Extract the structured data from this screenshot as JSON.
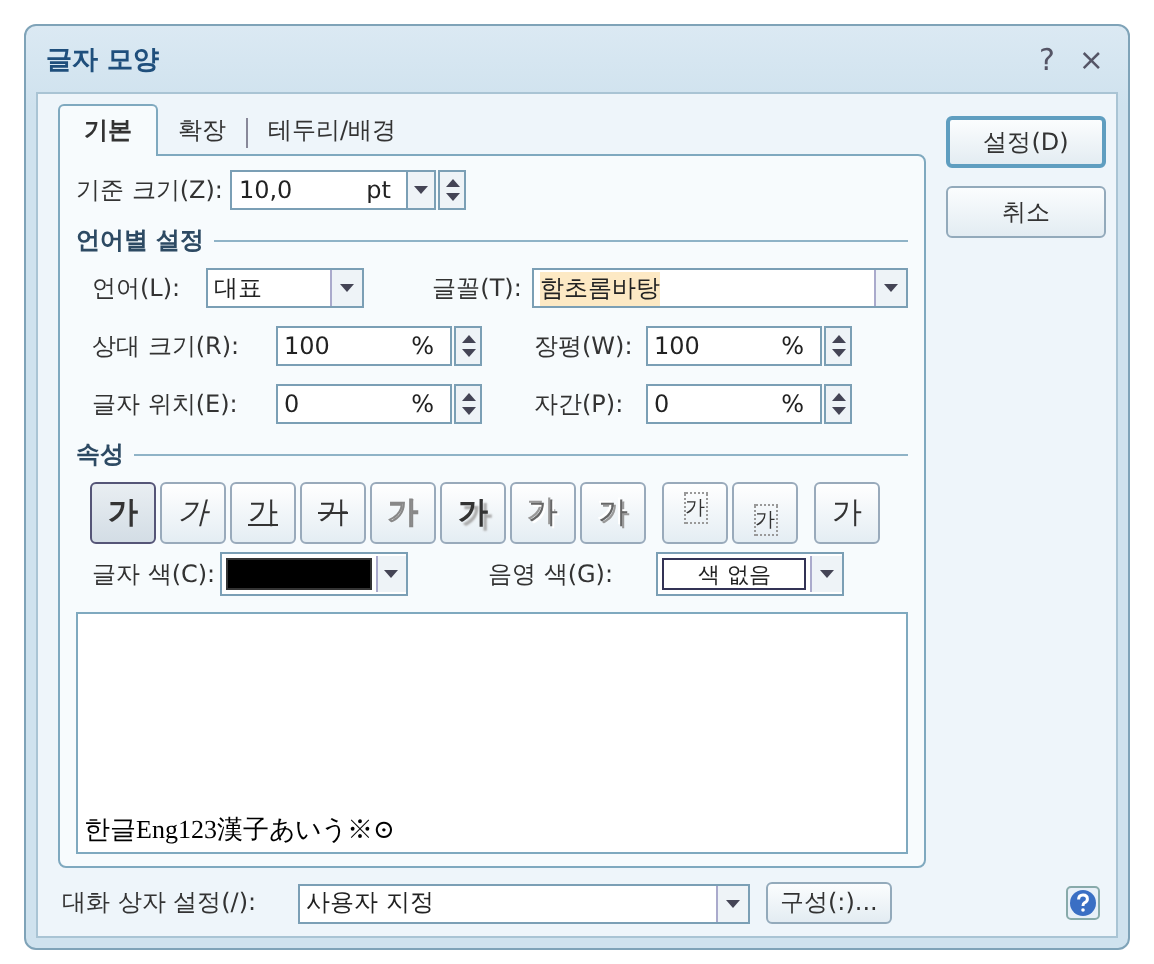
{
  "window": {
    "title": "글자 모양",
    "help": "?",
    "close": "×"
  },
  "tabs": [
    {
      "label": "기본",
      "selected": true
    },
    {
      "label": "확장",
      "selected": false
    },
    {
      "label": "테두리/배경",
      "selected": false
    }
  ],
  "base_size": {
    "label": "기준 크기(Z):",
    "value": "10,0",
    "unit": "pt"
  },
  "language_section": {
    "title": "언어별 설정",
    "language": {
      "label": "언어(L):",
      "value": "대표"
    },
    "font": {
      "label": "글꼴(T):",
      "value": "함초롬바탕"
    },
    "fields": [
      {
        "label": "상대 크기(R):",
        "value": "100",
        "unit": "%"
      },
      {
        "label": "장평(W):",
        "value": "100",
        "unit": "%"
      },
      {
        "label": "글자 위치(E):",
        "value": "0",
        "unit": "%"
      },
      {
        "label": "자간(P):",
        "value": "0",
        "unit": "%"
      }
    ]
  },
  "attributes_section": {
    "title": "속성",
    "buttons": [
      {
        "kind": "bold",
        "text": "가",
        "selected": true
      },
      {
        "kind": "italic",
        "text": "가",
        "selected": false
      },
      {
        "kind": "underline",
        "text": "가",
        "selected": false
      },
      {
        "kind": "strike",
        "text": "가",
        "selected": false
      },
      {
        "kind": "outline",
        "text": "가",
        "selected": false
      },
      {
        "kind": "shadow",
        "text": "가",
        "selected": false
      },
      {
        "kind": "emboss",
        "text": "가",
        "selected": false
      },
      {
        "kind": "engrave",
        "text": "가",
        "selected": false
      },
      {
        "kind": "superscript",
        "text": "가",
        "selected": false
      },
      {
        "kind": "subscript",
        "text": "가",
        "selected": false
      },
      {
        "kind": "normal",
        "text": "가",
        "selected": false
      }
    ],
    "text_color": {
      "label": "글자 색(C):",
      "color": "#000000"
    },
    "shade_color": {
      "label": "음영 색(G):",
      "value": "색 없음"
    }
  },
  "preview": {
    "text": "한글Eng123漢子あいう※⊙"
  },
  "actions": [
    {
      "label": "설정(D)",
      "default": true
    },
    {
      "label": "취소",
      "default": false
    }
  ],
  "footer": {
    "label": "대화 상자 설정(/):",
    "value": "사용자 지정",
    "configure": "구성(:)..."
  }
}
